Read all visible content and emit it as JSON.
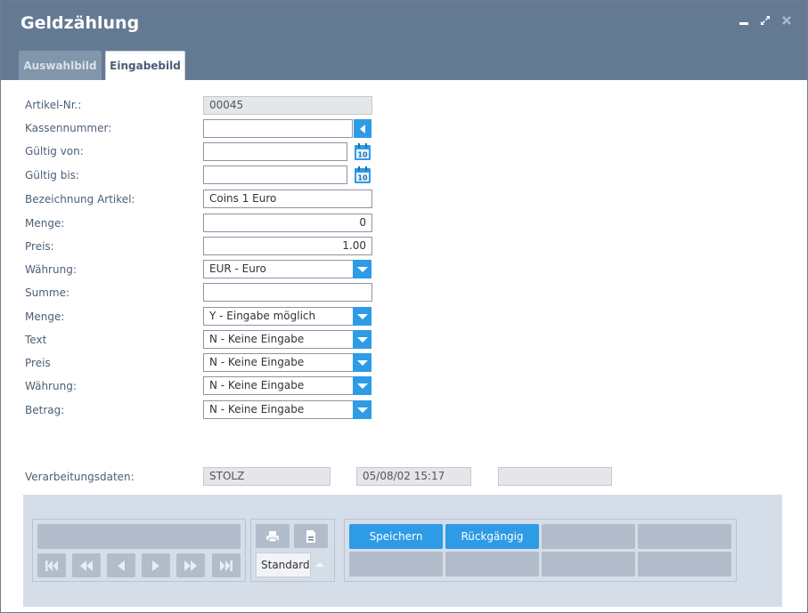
{
  "window": {
    "title": "Geldzählung",
    "controls": {
      "minimize": "minimize-icon",
      "maximize": "maximize-icon",
      "close": "close-icon"
    }
  },
  "tabs": [
    {
      "label": "Auswahlbild",
      "active": false
    },
    {
      "label": "Eingabebild",
      "active": true
    }
  ],
  "form": {
    "artikel_nr": {
      "label": "Artikel-Nr.:",
      "value": "00045"
    },
    "kassennummer": {
      "label": "Kassennummer:",
      "value": ""
    },
    "gueltig_von": {
      "label": "Gültig von:",
      "value": "",
      "calendar_day": "10"
    },
    "gueltig_bis": {
      "label": "Gültig bis:",
      "value": "",
      "calendar_day": "10"
    },
    "bezeichnung": {
      "label": "Bezeichnung Artikel:",
      "value": "Coins 1 Euro"
    },
    "menge": {
      "label": "Menge:",
      "value": "0"
    },
    "preis": {
      "label": "Preis:",
      "value": "1.00"
    },
    "waehrung": {
      "label": "Währung:",
      "value": "EUR - Euro"
    },
    "summe": {
      "label": "Summe:",
      "value": ""
    },
    "menge_sel": {
      "label": "Menge:",
      "value": "Y - Eingabe möglich"
    },
    "text_sel": {
      "label": "Text",
      "value": "N - Keine Eingabe"
    },
    "preis_sel": {
      "label": "Preis",
      "value": "N - Keine Eingabe"
    },
    "waehrung_sel": {
      "label": "Währung:",
      "value": "N - Keine Eingabe"
    },
    "betrag_sel": {
      "label": "Betrag:",
      "value": "N - Keine Eingabe"
    }
  },
  "verarbeitung": {
    "label": "Verarbeitungsdaten:",
    "user": "STOLZ",
    "datetime": "05/08/02 15:17",
    "extra": ""
  },
  "toolbar": {
    "standard_label": "Standardli",
    "save_label": "Speichern",
    "undo_label": "Rückgängig"
  },
  "colors": {
    "titlebar": "#647a93",
    "accent": "#2e9be6",
    "label": "#4d6076",
    "panel": "#d5dde8"
  }
}
